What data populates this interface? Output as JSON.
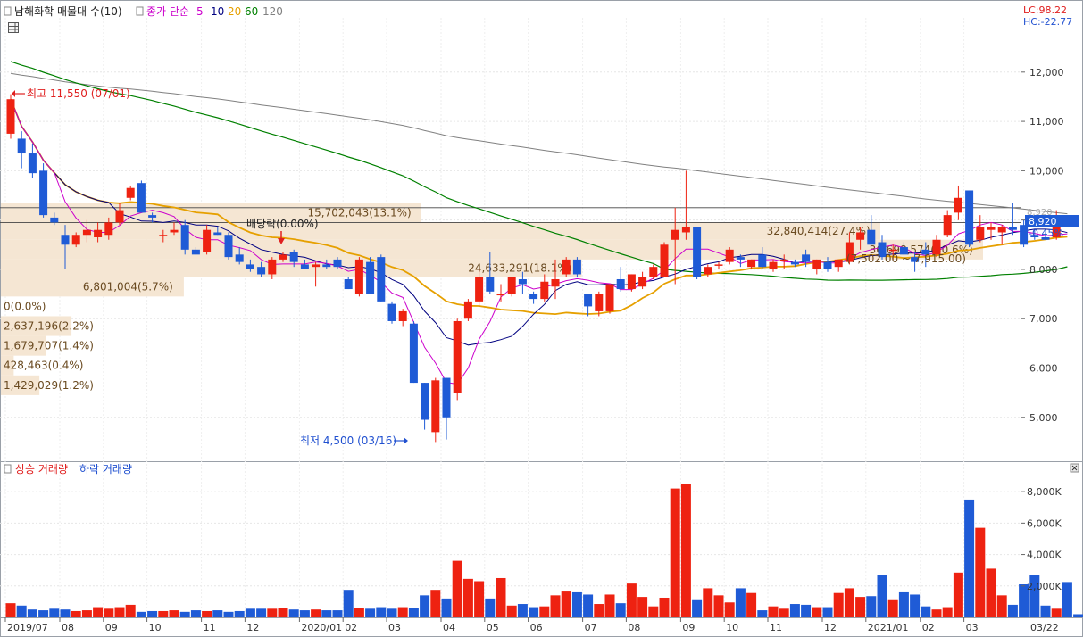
{
  "price_panel": {
    "legend": {
      "title": "남해화학 매물대 수(10)",
      "ma_label": "종가 단순",
      "ma_periods": [
        "5",
        "10",
        "20",
        "60",
        "120"
      ],
      "ma_colors": [
        "#cc00cc",
        "#000080",
        "#e6a000",
        "#008000",
        "#808080"
      ]
    },
    "lc": "LC:98.22",
    "hc": "HC:-22.77",
    "high_marker": "최고 11,550 (07/01)",
    "low_marker": "최저 4,500 (03/16)",
    "dividend_marker": "배당락(0.00%)",
    "current_price": "8,920",
    "current_change": "-0.45%",
    "current_price_hidden": "8,920",
    "range_label": "(7,502.00 ~ 7,915.00)",
    "volume_profile": [
      {
        "label": "15,702,043(13.1%)",
        "lo": 8950,
        "hi": 9350
      },
      {
        "label": "32,840,414(27.4%)",
        "lo": 8600,
        "hi": 8950
      },
      {
        "label": "36,698,574(30.6%)",
        "lo": 8200,
        "hi": 8600
      },
      {
        "label": "24,633,291(18.1%)",
        "lo": 7850,
        "hi": 8200
      },
      {
        "label": "6,801,004(5.7%)",
        "lo": 7450,
        "hi": 7850
      },
      {
        "label": "0(0.0%)",
        "lo": 7050,
        "hi": 7450
      },
      {
        "label": "2,637,196(2.2%)",
        "lo": 6650,
        "hi": 7050
      },
      {
        "label": "1,679,707(1.4%)",
        "lo": 6250,
        "hi": 6650
      },
      {
        "label": "428,463(0.4%)",
        "lo": 5850,
        "hi": 6250
      },
      {
        "label": "1,429,029(1.2%)",
        "lo": 5450,
        "hi": 5850
      }
    ]
  },
  "volume_panel": {
    "legend_up": "상승 거래량",
    "legend_down": "하락 거래량",
    "up_color": "#ee2211",
    "down_color": "#1f5bd6"
  },
  "x_axis_labels": [
    "2019/07",
    "08",
    "09",
    "10",
    "11",
    "12",
    "2020/01",
    "02",
    "03",
    "04",
    "05",
    "06",
    "07",
    "08",
    "09",
    "10",
    "11",
    "12",
    "2021/01",
    "02",
    "03",
    "03/22"
  ],
  "chart_data": [
    {
      "type": "candlestick",
      "yticks": [
        "12,000",
        "11,000",
        "10,000",
        "9,000",
        "8,000",
        "7,000",
        "6,000",
        "5,000"
      ],
      "ylim": [
        4200,
        13100
      ],
      "candles": [
        {
          "o": 10750,
          "h": 11550,
          "l": 10650,
          "c": 11450
        },
        {
          "o": 10650,
          "h": 10800,
          "l": 10050,
          "c": 10350
        },
        {
          "o": 10350,
          "h": 10550,
          "l": 9850,
          "c": 9950
        },
        {
          "o": 10000,
          "h": 10150,
          "l": 9050,
          "c": 9100
        },
        {
          "o": 9050,
          "h": 9150,
          "l": 8900,
          "c": 8950
        },
        {
          "o": 8700,
          "h": 8900,
          "l": 8000,
          "c": 8500
        },
        {
          "o": 8500,
          "h": 8750,
          "l": 8450,
          "c": 8700
        },
        {
          "o": 8700,
          "h": 9000,
          "l": 8550,
          "c": 8800
        },
        {
          "o": 8650,
          "h": 8950,
          "l": 8550,
          "c": 8800
        },
        {
          "o": 8700,
          "h": 9050,
          "l": 8600,
          "c": 8950
        },
        {
          "o": 8950,
          "h": 9350,
          "l": 8900,
          "c": 9200
        },
        {
          "o": 9450,
          "h": 9700,
          "l": 9400,
          "c": 9650
        },
        {
          "o": 9750,
          "h": 9800,
          "l": 9150,
          "c": 9150
        },
        {
          "o": 9100,
          "h": 9150,
          "l": 8950,
          "c": 9050
        },
        {
          "o": 8700,
          "h": 8800,
          "l": 8550,
          "c": 8700
        },
        {
          "o": 8750,
          "h": 8950,
          "l": 8700,
          "c": 8800
        },
        {
          "o": 8900,
          "h": 9000,
          "l": 8300,
          "c": 8400
        },
        {
          "o": 8400,
          "h": 8450,
          "l": 8300,
          "c": 8300
        },
        {
          "o": 8350,
          "h": 8900,
          "l": 8300,
          "c": 8800
        },
        {
          "o": 8750,
          "h": 8850,
          "l": 8700,
          "c": 8700
        },
        {
          "o": 8700,
          "h": 8750,
          "l": 8200,
          "c": 8250
        },
        {
          "o": 8300,
          "h": 8450,
          "l": 8100,
          "c": 8150
        },
        {
          "o": 8100,
          "h": 8200,
          "l": 7950,
          "c": 8000
        },
        {
          "o": 8050,
          "h": 8150,
          "l": 7850,
          "c": 7900
        },
        {
          "o": 7900,
          "h": 8250,
          "l": 7800,
          "c": 8200
        },
        {
          "o": 8200,
          "h": 8350,
          "l": 8150,
          "c": 8300
        },
        {
          "o": 8350,
          "h": 8400,
          "l": 8050,
          "c": 8150
        },
        {
          "o": 8100,
          "h": 8200,
          "l": 8000,
          "c": 8000
        },
        {
          "o": 8050,
          "h": 8150,
          "l": 7650,
          "c": 8100
        },
        {
          "o": 8100,
          "h": 8200,
          "l": 8000,
          "c": 8050
        },
        {
          "o": 8200,
          "h": 8250,
          "l": 8000,
          "c": 8050
        },
        {
          "o": 7800,
          "h": 7850,
          "l": 7600,
          "c": 7600
        },
        {
          "o": 7500,
          "h": 8250,
          "l": 7450,
          "c": 8200
        },
        {
          "o": 8150,
          "h": 8250,
          "l": 7500,
          "c": 7500
        },
        {
          "o": 8250,
          "h": 8300,
          "l": 7350,
          "c": 7350
        },
        {
          "o": 7300,
          "h": 7350,
          "l": 6900,
          "c": 6950
        },
        {
          "o": 6950,
          "h": 7200,
          "l": 6850,
          "c": 7150
        },
        {
          "o": 6900,
          "h": 6950,
          "l": 5700,
          "c": 5700
        },
        {
          "o": 5700,
          "h": 5700,
          "l": 4750,
          "c": 4950
        },
        {
          "o": 4700,
          "h": 5800,
          "l": 4500,
          "c": 5750
        },
        {
          "o": 5800,
          "h": 5800,
          "l": 4550,
          "c": 5000
        },
        {
          "o": 5500,
          "h": 7000,
          "l": 5350,
          "c": 6950
        },
        {
          "o": 7000,
          "h": 7400,
          "l": 6950,
          "c": 7350
        },
        {
          "o": 7350,
          "h": 8000,
          "l": 7250,
          "c": 7850
        },
        {
          "o": 7850,
          "h": 8350,
          "l": 7500,
          "c": 7550
        },
        {
          "o": 7500,
          "h": 7700,
          "l": 7350,
          "c": 7500
        },
        {
          "o": 7500,
          "h": 7850,
          "l": 7450,
          "c": 7850
        },
        {
          "o": 7800,
          "h": 7950,
          "l": 7500,
          "c": 7700
        },
        {
          "o": 7500,
          "h": 7550,
          "l": 7300,
          "c": 7400
        },
        {
          "o": 7400,
          "h": 7900,
          "l": 7350,
          "c": 7750
        },
        {
          "o": 7650,
          "h": 8200,
          "l": 7400,
          "c": 7800
        },
        {
          "o": 7900,
          "h": 8250,
          "l": 7850,
          "c": 8200
        },
        {
          "o": 8200,
          "h": 8250,
          "l": 7850,
          "c": 7900
        },
        {
          "o": 7500,
          "h": 7500,
          "l": 7050,
          "c": 7250
        },
        {
          "o": 7150,
          "h": 7550,
          "l": 7050,
          "c": 7500
        },
        {
          "o": 7150,
          "h": 7700,
          "l": 7100,
          "c": 7700
        },
        {
          "o": 7800,
          "h": 8050,
          "l": 7550,
          "c": 7600
        },
        {
          "o": 7600,
          "h": 7900,
          "l": 7550,
          "c": 7900
        },
        {
          "o": 7650,
          "h": 7950,
          "l": 7600,
          "c": 7850
        },
        {
          "o": 7850,
          "h": 8100,
          "l": 7800,
          "c": 8050
        },
        {
          "o": 7850,
          "h": 8550,
          "l": 7850,
          "c": 8500
        },
        {
          "o": 8600,
          "h": 9250,
          "l": 7700,
          "c": 8800
        },
        {
          "o": 8750,
          "h": 10000,
          "l": 8600,
          "c": 8850
        },
        {
          "o": 8850,
          "h": 8850,
          "l": 7800,
          "c": 7850
        },
        {
          "o": 7900,
          "h": 8100,
          "l": 7850,
          "c": 8050
        },
        {
          "o": 8100,
          "h": 8150,
          "l": 8000,
          "c": 8100
        },
        {
          "o": 8150,
          "h": 8450,
          "l": 8100,
          "c": 8400
        },
        {
          "o": 8250,
          "h": 8300,
          "l": 8050,
          "c": 8200
        },
        {
          "o": 8050,
          "h": 8200,
          "l": 8000,
          "c": 8200
        },
        {
          "o": 8300,
          "h": 8450,
          "l": 8000,
          "c": 8050
        },
        {
          "o": 8000,
          "h": 8200,
          "l": 7950,
          "c": 8150
        },
        {
          "o": 8200,
          "h": 8300,
          "l": 8000,
          "c": 8200
        },
        {
          "o": 8150,
          "h": 8200,
          "l": 8050,
          "c": 8100
        },
        {
          "o": 8300,
          "h": 8400,
          "l": 8050,
          "c": 8150
        },
        {
          "o": 8000,
          "h": 8200,
          "l": 7900,
          "c": 8200
        },
        {
          "o": 8150,
          "h": 8250,
          "l": 7950,
          "c": 8000
        },
        {
          "o": 8050,
          "h": 8200,
          "l": 7950,
          "c": 8200
        },
        {
          "o": 8150,
          "h": 8750,
          "l": 8100,
          "c": 8550
        },
        {
          "o": 8600,
          "h": 8850,
          "l": 8400,
          "c": 8750
        },
        {
          "o": 8800,
          "h": 9100,
          "l": 8500,
          "c": 8500
        },
        {
          "o": 8550,
          "h": 8700,
          "l": 8200,
          "c": 8250
        },
        {
          "o": 8400,
          "h": 8500,
          "l": 8200,
          "c": 8400
        },
        {
          "o": 8450,
          "h": 8550,
          "l": 8300,
          "c": 8300
        },
        {
          "o": 8250,
          "h": 8350,
          "l": 7950,
          "c": 8150
        },
        {
          "o": 8400,
          "h": 8550,
          "l": 8050,
          "c": 8300
        },
        {
          "o": 8300,
          "h": 8700,
          "l": 8250,
          "c": 8600
        },
        {
          "o": 8700,
          "h": 9200,
          "l": 8650,
          "c": 9100
        },
        {
          "o": 9150,
          "h": 9700,
          "l": 9000,
          "c": 9450
        },
        {
          "o": 9600,
          "h": 9600,
          "l": 8450,
          "c": 8500
        },
        {
          "o": 8600,
          "h": 9100,
          "l": 8550,
          "c": 8850
        },
        {
          "o": 8800,
          "h": 8950,
          "l": 8600,
          "c": 8850
        },
        {
          "o": 8750,
          "h": 8900,
          "l": 8500,
          "c": 8850
        },
        {
          "o": 8850,
          "h": 9350,
          "l": 8700,
          "c": 8800
        },
        {
          "o": 8900,
          "h": 9000,
          "l": 8450,
          "c": 8500
        },
        {
          "o": 8700,
          "h": 8800,
          "l": 8600,
          "c": 8650
        },
        {
          "o": 8650,
          "h": 8750,
          "l": 8600,
          "c": 8600
        },
        {
          "o": 8650,
          "h": 9200,
          "l": 8600,
          "c": 8950
        },
        {
          "o": 8950,
          "h": 9050,
          "l": 8850,
          "c": 8900
        }
      ]
    },
    {
      "type": "bar",
      "yticks": [
        "8,000K",
        "6,000K",
        "4,000K",
        "2,000K"
      ],
      "ylim": [
        0,
        9200
      ],
      "unit": "K",
      "volumes": [
        900,
        750,
        500,
        450,
        550,
        500,
        400,
        450,
        650,
        550,
        650,
        800,
        350,
        400,
        400,
        450,
        350,
        450,
        400,
        450,
        350,
        400,
        550,
        550,
        550,
        600,
        500,
        450,
        500,
        450,
        450,
        1750,
        600,
        550,
        650,
        550,
        650,
        600,
        1400,
        1750,
        1200,
        3600,
        2450,
        2300,
        1200,
        2500,
        750,
        850,
        650,
        700,
        1400,
        1700,
        1650,
        1450,
        850,
        1450,
        900,
        2150,
        1300,
        700,
        1250,
        8200,
        8500,
        1150,
        1850,
        1400,
        950,
        1850,
        1550,
        450,
        700,
        550,
        850,
        800,
        650,
        650,
        1550,
        1850,
        1300,
        1350,
        2700,
        1150,
        1650,
        1450,
        700,
        500,
        650,
        2850,
        7500,
        5700,
        3100,
        1400,
        800,
        2100,
        2700,
        750,
        550,
        2250,
        200
      ]
    }
  ]
}
